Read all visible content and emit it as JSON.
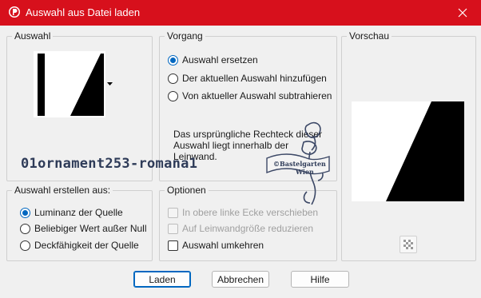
{
  "window": {
    "title": "Auswahl aus Datei laden"
  },
  "auswahl": {
    "label": "Auswahl"
  },
  "vorgang": {
    "label": "Vorgang",
    "options": [
      "Auswahl ersetzen",
      "Der aktuellen Auswahl hinzufügen",
      "Von aktueller Auswahl subtrahieren"
    ],
    "selected_index": 0,
    "note": "Das ursprüngliche Rechteck dieser Auswahl liegt innerhalb der Leinwand."
  },
  "vorschau": {
    "label": "Vorschau"
  },
  "erstellen": {
    "label": "Auswahl erstellen aus:",
    "options": [
      "Luminanz der Quelle",
      "Beliebiger Wert außer Null",
      "Deckfähigkeit der Quelle"
    ],
    "selected_index": 0
  },
  "optionen": {
    "label": "Optionen",
    "checkboxes": [
      {
        "label": "In obere linke Ecke verschieben",
        "checked": false,
        "enabled": false
      },
      {
        "label": "Auf Leinwandgröße reduzieren",
        "checked": false,
        "enabled": false
      },
      {
        "label": "Auswahl umkehren",
        "checked": false,
        "enabled": true
      }
    ]
  },
  "buttons": {
    "load": "Laden",
    "cancel": "Abbrechen",
    "help": "Hilfe"
  },
  "watermark": {
    "text": "01ornament253-romana1",
    "stamp_line1": "©Bastelgarten",
    "stamp_line2": "Wien"
  },
  "colors": {
    "titlebar": "#d7101c",
    "accent": "#0067c0"
  }
}
